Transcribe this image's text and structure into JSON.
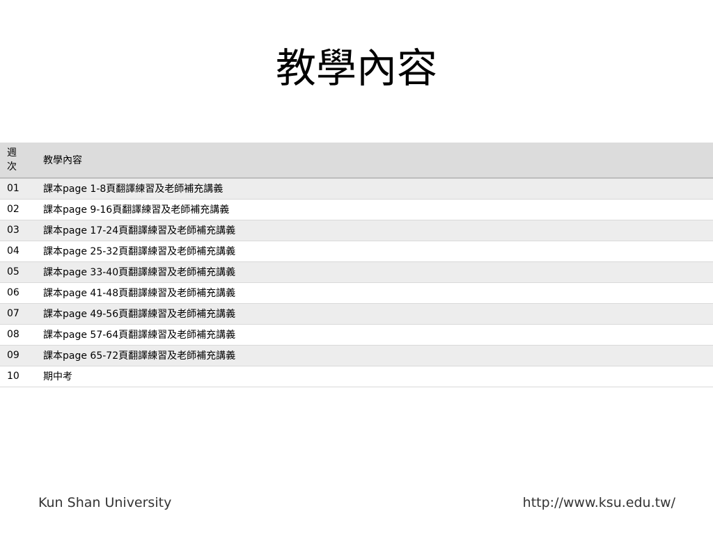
{
  "slide": {
    "title": "教學內容"
  },
  "table": {
    "headers": {
      "week": "週\n次",
      "content": "教學內容"
    },
    "rows": [
      {
        "week": "01",
        "content": "課本page 1-8頁翻譯練習及老師補充講義"
      },
      {
        "week": "02",
        "content": "課本page 9-16頁翻譯練習及老師補充講義"
      },
      {
        "week": "03",
        "content": "課本page 17-24頁翻譯練習及老師補充講義"
      },
      {
        "week": "04",
        "content": "課本page 25-32頁翻譯練習及老師補充講義"
      },
      {
        "week": "05",
        "content": "課本page 33-40頁翻譯練習及老師補充講義"
      },
      {
        "week": "06",
        "content": "課本page 41-48頁翻譯練習及老師補充講義"
      },
      {
        "week": "07",
        "content": "課本page 49-56頁翻譯練習及老師補充講義"
      },
      {
        "week": "08",
        "content": "課本page 57-64頁翻譯練習及老師補充講義"
      },
      {
        "week": "09",
        "content": "課本page 65-72頁翻譯練習及老師補充講義"
      },
      {
        "week": "10",
        "content": "期中考"
      }
    ]
  },
  "footer": {
    "left": "Kun Shan University",
    "right": "http://www.ksu.edu.tw/"
  },
  "colors": {
    "header_bg": "#dcdcdc",
    "row_alt_bg": "#ededed",
    "row_bg": "#ffffff"
  }
}
